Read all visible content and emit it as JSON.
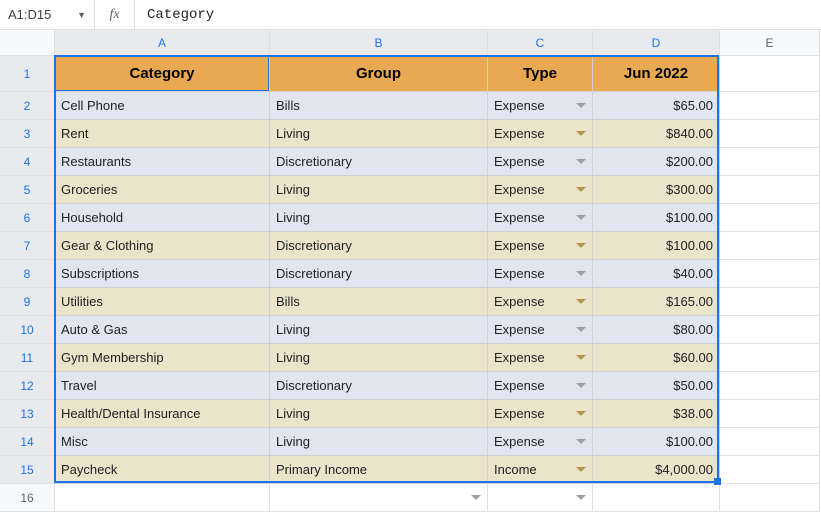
{
  "formula_bar": {
    "name_box": "A1:D15",
    "fx_label": "fx",
    "formula_value": "Category"
  },
  "columns": [
    "A",
    "B",
    "C",
    "D",
    "E"
  ],
  "headers": {
    "category": "Category",
    "group": "Group",
    "type": "Type",
    "month": "Jun 2022"
  },
  "rows": [
    {
      "n": "2",
      "category": "Cell Phone",
      "group": "Bills",
      "type": "Expense",
      "amount": "$65.00",
      "alt": false
    },
    {
      "n": "3",
      "category": "Rent",
      "group": "Living",
      "type": "Expense",
      "amount": "$840.00",
      "alt": true
    },
    {
      "n": "4",
      "category": "Restaurants",
      "group": "Discretionary",
      "type": "Expense",
      "amount": "$200.00",
      "alt": false
    },
    {
      "n": "5",
      "category": "Groceries",
      "group": "Living",
      "type": "Expense",
      "amount": "$300.00",
      "alt": true
    },
    {
      "n": "6",
      "category": "Household",
      "group": "Living",
      "type": "Expense",
      "amount": "$100.00",
      "alt": false
    },
    {
      "n": "7",
      "category": "Gear & Clothing",
      "group": "Discretionary",
      "type": "Expense",
      "amount": "$100.00",
      "alt": true
    },
    {
      "n": "8",
      "category": "Subscriptions",
      "group": "Discretionary",
      "type": "Expense",
      "amount": "$40.00",
      "alt": false
    },
    {
      "n": "9",
      "category": "Utilities",
      "group": "Bills",
      "type": "Expense",
      "amount": "$165.00",
      "alt": true
    },
    {
      "n": "10",
      "category": "Auto & Gas",
      "group": "Living",
      "type": "Expense",
      "amount": "$80.00",
      "alt": false
    },
    {
      "n": "11",
      "category": "Gym Membership",
      "group": "Living",
      "type": "Expense",
      "amount": "$60.00",
      "alt": true
    },
    {
      "n": "12",
      "category": "Travel",
      "group": "Discretionary",
      "type": "Expense",
      "amount": "$50.00",
      "alt": false
    },
    {
      "n": "13",
      "category": "Health/Dental Insurance",
      "group": "Living",
      "type": "Expense",
      "amount": "$38.00",
      "alt": true
    },
    {
      "n": "14",
      "category": "Misc",
      "group": "Living",
      "type": "Expense",
      "amount": "$100.00",
      "alt": false
    },
    {
      "n": "15",
      "category": "Paycheck",
      "group": "Primary Income",
      "type": "Income",
      "amount": "$4,000.00",
      "alt": true
    }
  ],
  "empty_row": "16",
  "chart_data": {
    "type": "table",
    "columns": [
      "Category",
      "Group",
      "Type",
      "Jun 2022"
    ],
    "data": [
      [
        "Cell Phone",
        "Bills",
        "Expense",
        65.0
      ],
      [
        "Rent",
        "Living",
        "Expense",
        840.0
      ],
      [
        "Restaurants",
        "Discretionary",
        "Expense",
        200.0
      ],
      [
        "Groceries",
        "Living",
        "Expense",
        300.0
      ],
      [
        "Household",
        "Living",
        "Expense",
        100.0
      ],
      [
        "Gear & Clothing",
        "Discretionary",
        "Expense",
        100.0
      ],
      [
        "Subscriptions",
        "Discretionary",
        "Expense",
        40.0
      ],
      [
        "Utilities",
        "Bills",
        "Expense",
        165.0
      ],
      [
        "Auto & Gas",
        "Living",
        "Expense",
        80.0
      ],
      [
        "Gym Membership",
        "Living",
        "Expense",
        60.0
      ],
      [
        "Travel",
        "Discretionary",
        "Expense",
        50.0
      ],
      [
        "Health/Dental Insurance",
        "Living",
        "Expense",
        38.0
      ],
      [
        "Misc",
        "Living",
        "Expense",
        100.0
      ],
      [
        "Paycheck",
        "Primary Income",
        "Income",
        4000.0
      ]
    ]
  }
}
